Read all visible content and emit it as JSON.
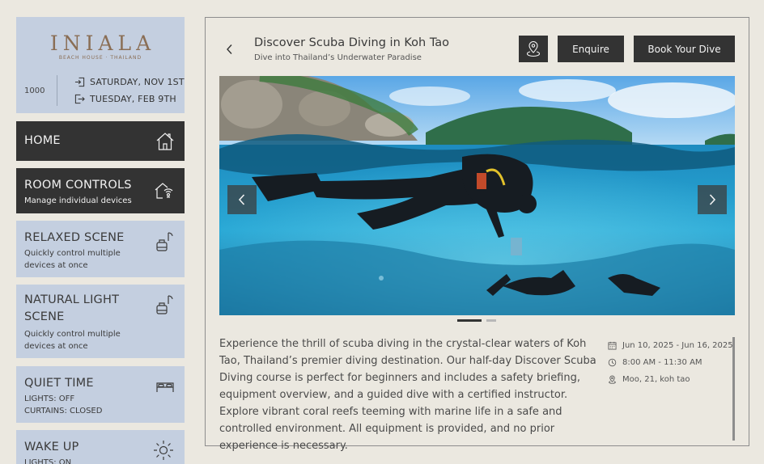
{
  "brand": {
    "logo": "INIALA",
    "tagline": "BEACH HOUSE · THAILAND",
    "room_number": "1000",
    "checkin": "SATURDAY, NOV 1ST",
    "checkout": "TUESDAY, FEB 9TH"
  },
  "nav": {
    "home": {
      "title": "HOME",
      "icon": "home-icon"
    },
    "room_controls": {
      "title": "ROOM CONTROLS",
      "subtitle": "Manage individual devices",
      "icon": "home-remote-icon"
    },
    "relaxed": {
      "title": "RELAXED SCENE",
      "subtitle": "Quickly control multiple devices at once",
      "icon": "lamp-icon"
    },
    "natural": {
      "title": "NATURAL LIGHT SCENE",
      "subtitle": "Quickly control multiple devices at once",
      "icon": "lamp-icon"
    },
    "quiet": {
      "title": "QUIET TIME",
      "line1": "LIGHTS: OFF",
      "line2": "CURTAINS: CLOSED",
      "icon": "bed-icon"
    },
    "wake": {
      "title": "WAKE UP",
      "line1": "LIGHTS: ON",
      "icon": "sun-icon"
    }
  },
  "activity": {
    "title": "Discover Scuba Diving in Koh Tao",
    "subtitle": "Dive into Thailand’s Underwater Paradise",
    "enquire_label": "Enquire",
    "book_label": "Book Your Dive",
    "description": "Experience the thrill of scuba diving in the crystal-clear waters of Koh Tao, Thailand’s premier diving destination. Our half-day Discover Scuba Diving course is perfect for beginners and includes a safety briefing, equipment overview, and a guided dive with a certified instructor. Explore vibrant coral reefs teeming with marine life in a safe and controlled environment. All equipment is provided, and no prior experience is necessary.",
    "dates": "Jun 10, 2025 - Jun 16, 2025",
    "time": "8:00 AM - 11:30 AM",
    "location": "Moo, 21, koh tao",
    "carousel": {
      "current_slide": 1,
      "total_slides": 2
    }
  },
  "colors": {
    "background": "#ebe8e0",
    "card_light": "#c4cfe0",
    "card_dark": "#333333",
    "logo": "#8a6e55"
  }
}
